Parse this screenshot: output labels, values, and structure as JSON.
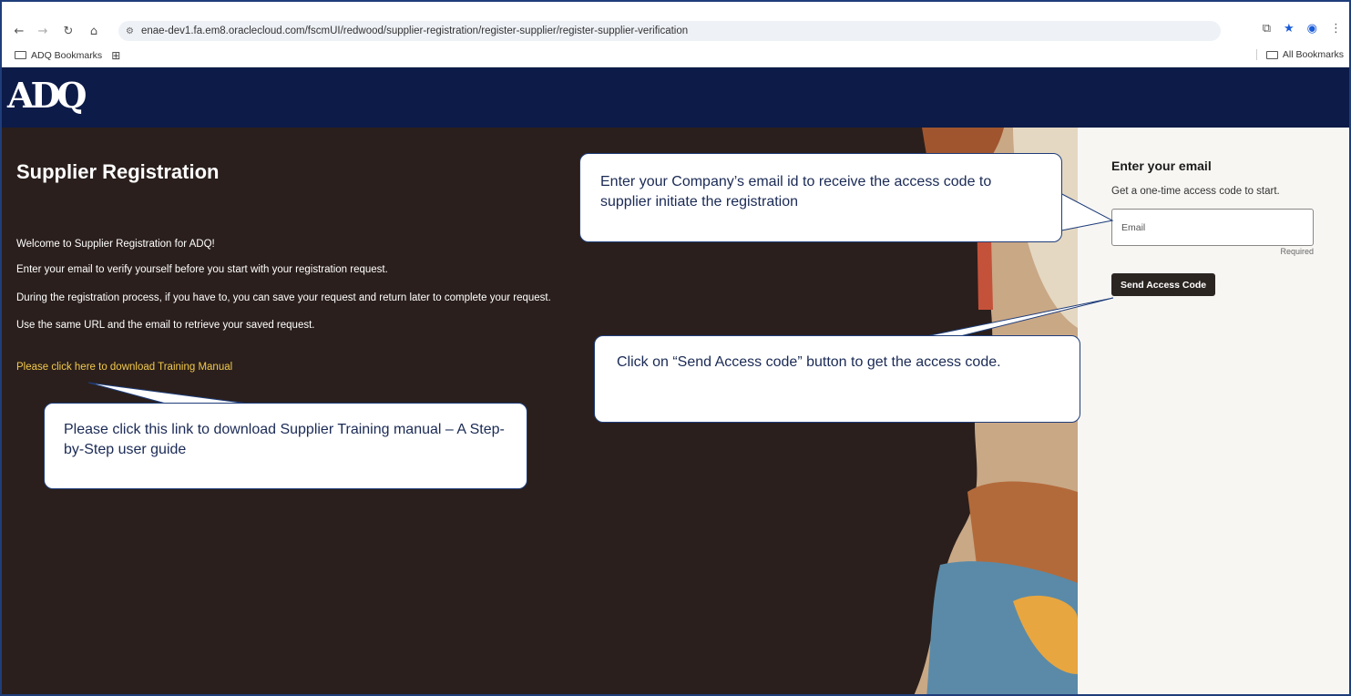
{
  "browser": {
    "url": "enae-dev1.fa.em8.oraclecloud.com/fscmUI/redwood/supplier-registration/register-supplier/register-supplier-verification",
    "bookmarks": {
      "left_label": "ADQ Bookmarks",
      "right_label": "All Bookmarks"
    }
  },
  "header": {
    "logo_text": "ADQ"
  },
  "hero": {
    "title": "Supplier Registration",
    "paragraphs": [
      "Welcome to Supplier Registration for ADQ!",
      "Enter your email to verify yourself before you start with your registration request.",
      "During the registration process, if you have to, you can save your request and return later to complete your request.",
      "Use the same URL and the email to retrieve your saved request."
    ],
    "training_link": "Please click here to download Training Manual"
  },
  "panel": {
    "title": "Enter your email",
    "subtitle": "Get a one-time access code to start.",
    "email_placeholder": "Email",
    "required_label": "Required",
    "send_button": "Send Access Code"
  },
  "callouts": {
    "email": "Enter your Company’s email id to receive the access code to supplier initiate the registration",
    "send": "Click on “Send Access code” button to get the access code.",
    "manual": "Please click this link to download Supplier Training manual – A Step-by-Step user guide"
  },
  "icons": [
    "back-icon",
    "forward-icon",
    "reload-icon",
    "home-icon",
    "site-info-icon",
    "cast-icon",
    "star-icon",
    "profile-icon",
    "menu-icon",
    "folder-icon",
    "apps-icon"
  ],
  "colors": {
    "header_bg": "#0c1b48",
    "hero_bg": "#2a1f1c",
    "link": "#f2c94c",
    "button_bg": "#2b2522",
    "panel_bg": "#f7f6f3"
  }
}
